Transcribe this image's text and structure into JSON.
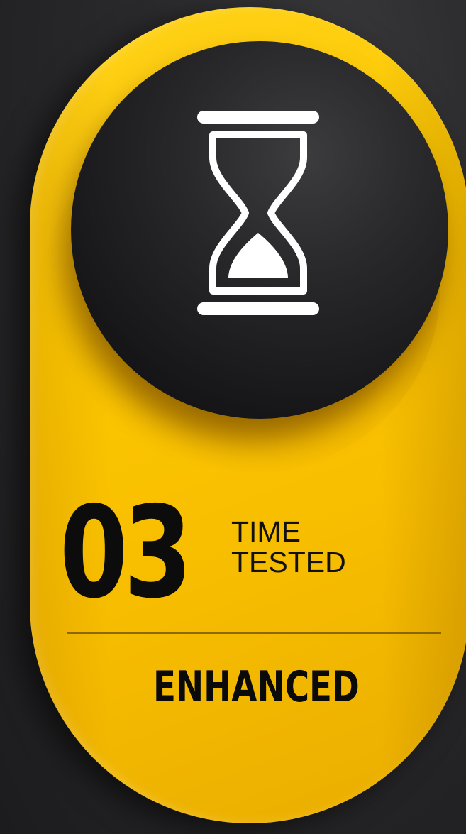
{
  "card": {
    "number": "03",
    "caption_line1": "TIME",
    "caption_line2": "TESTED",
    "tagline": "ENHANCED",
    "icon": "hourglass-icon"
  },
  "colors": {
    "background": "#2a2a2c",
    "card_yellow": "#fcc800",
    "disc_black": "#1a1a1c",
    "icon_white": "#ffffff",
    "text_dark": "#0c0c0c"
  }
}
